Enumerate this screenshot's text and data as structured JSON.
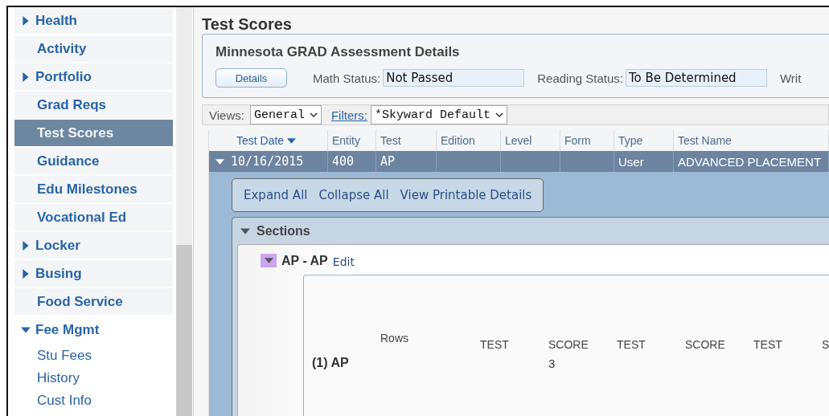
{
  "sidebar": {
    "items": [
      {
        "label": "Health",
        "kind": "group",
        "expanded": false,
        "selected": false
      },
      {
        "label": "Activity",
        "kind": "link",
        "selected": false
      },
      {
        "label": "Portfolio",
        "kind": "group",
        "expanded": false,
        "selected": false
      },
      {
        "label": "Grad Reqs",
        "kind": "link",
        "selected": false
      },
      {
        "label": "Test Scores",
        "kind": "link",
        "selected": true
      },
      {
        "label": "Guidance",
        "kind": "link",
        "selected": false
      },
      {
        "label": "Edu Milestones",
        "kind": "link",
        "selected": false
      },
      {
        "label": "Vocational Ed",
        "kind": "link",
        "selected": false
      },
      {
        "label": "Locker",
        "kind": "group",
        "expanded": false,
        "selected": false
      },
      {
        "label": "Busing",
        "kind": "group",
        "expanded": false,
        "selected": false
      },
      {
        "label": "Food Service",
        "kind": "link",
        "selected": false
      },
      {
        "label": "Fee Mgmt",
        "kind": "group",
        "expanded": true,
        "selected": false,
        "children": [
          {
            "label": "Stu Fees",
            "selected": false
          },
          {
            "label": "History",
            "selected": false
          },
          {
            "label": "Cust Info",
            "selected": false
          }
        ]
      }
    ]
  },
  "page_title": "Test Scores",
  "assessment": {
    "title": "Minnesota GRAD Assessment Details",
    "button": "Details",
    "fields": [
      {
        "label": "Math Status:",
        "value": "Not Passed"
      },
      {
        "label": "Reading Status:",
        "value": "To Be Determined"
      },
      {
        "label": "Writ"
      }
    ]
  },
  "views": {
    "label": "Views:",
    "value": "General"
  },
  "filters": {
    "label": "Filters:",
    "value": "*Skyward Default"
  },
  "table": {
    "columns": [
      {
        "label": "Test Date",
        "sorted": true
      },
      {
        "label": "Entity",
        "sorted": false
      },
      {
        "label": "Test",
        "sorted": false
      },
      {
        "label": "Edition",
        "sorted": false
      },
      {
        "label": "Level",
        "sorted": false
      },
      {
        "label": "Form",
        "sorted": false
      },
      {
        "label": "Type",
        "sorted": false
      },
      {
        "label": "Test Name",
        "sorted": false
      }
    ],
    "rows": [
      {
        "selected": true,
        "expanded": true,
        "cells": [
          "10/16/2015",
          "400",
          "AP",
          null,
          null,
          null,
          "User",
          "ADVANCED PLACEMENT"
        ]
      }
    ]
  },
  "detail": {
    "actions": [
      "Expand All",
      "Collapse All",
      "View Printable Details"
    ],
    "sections": {
      "title": "Sections",
      "expanded": true,
      "items": [
        {
          "title": "AP - AP",
          "edit": "Edit",
          "expanded": true,
          "columns": [
            "Rows",
            "TEST",
            "SCORE",
            "TEST",
            "SCORE",
            "TEST",
            "S"
          ],
          "rows": [
            {
              "cells": [
                "(1) AP",
                null,
                "3"
              ]
            }
          ]
        }
      ]
    }
  }
}
